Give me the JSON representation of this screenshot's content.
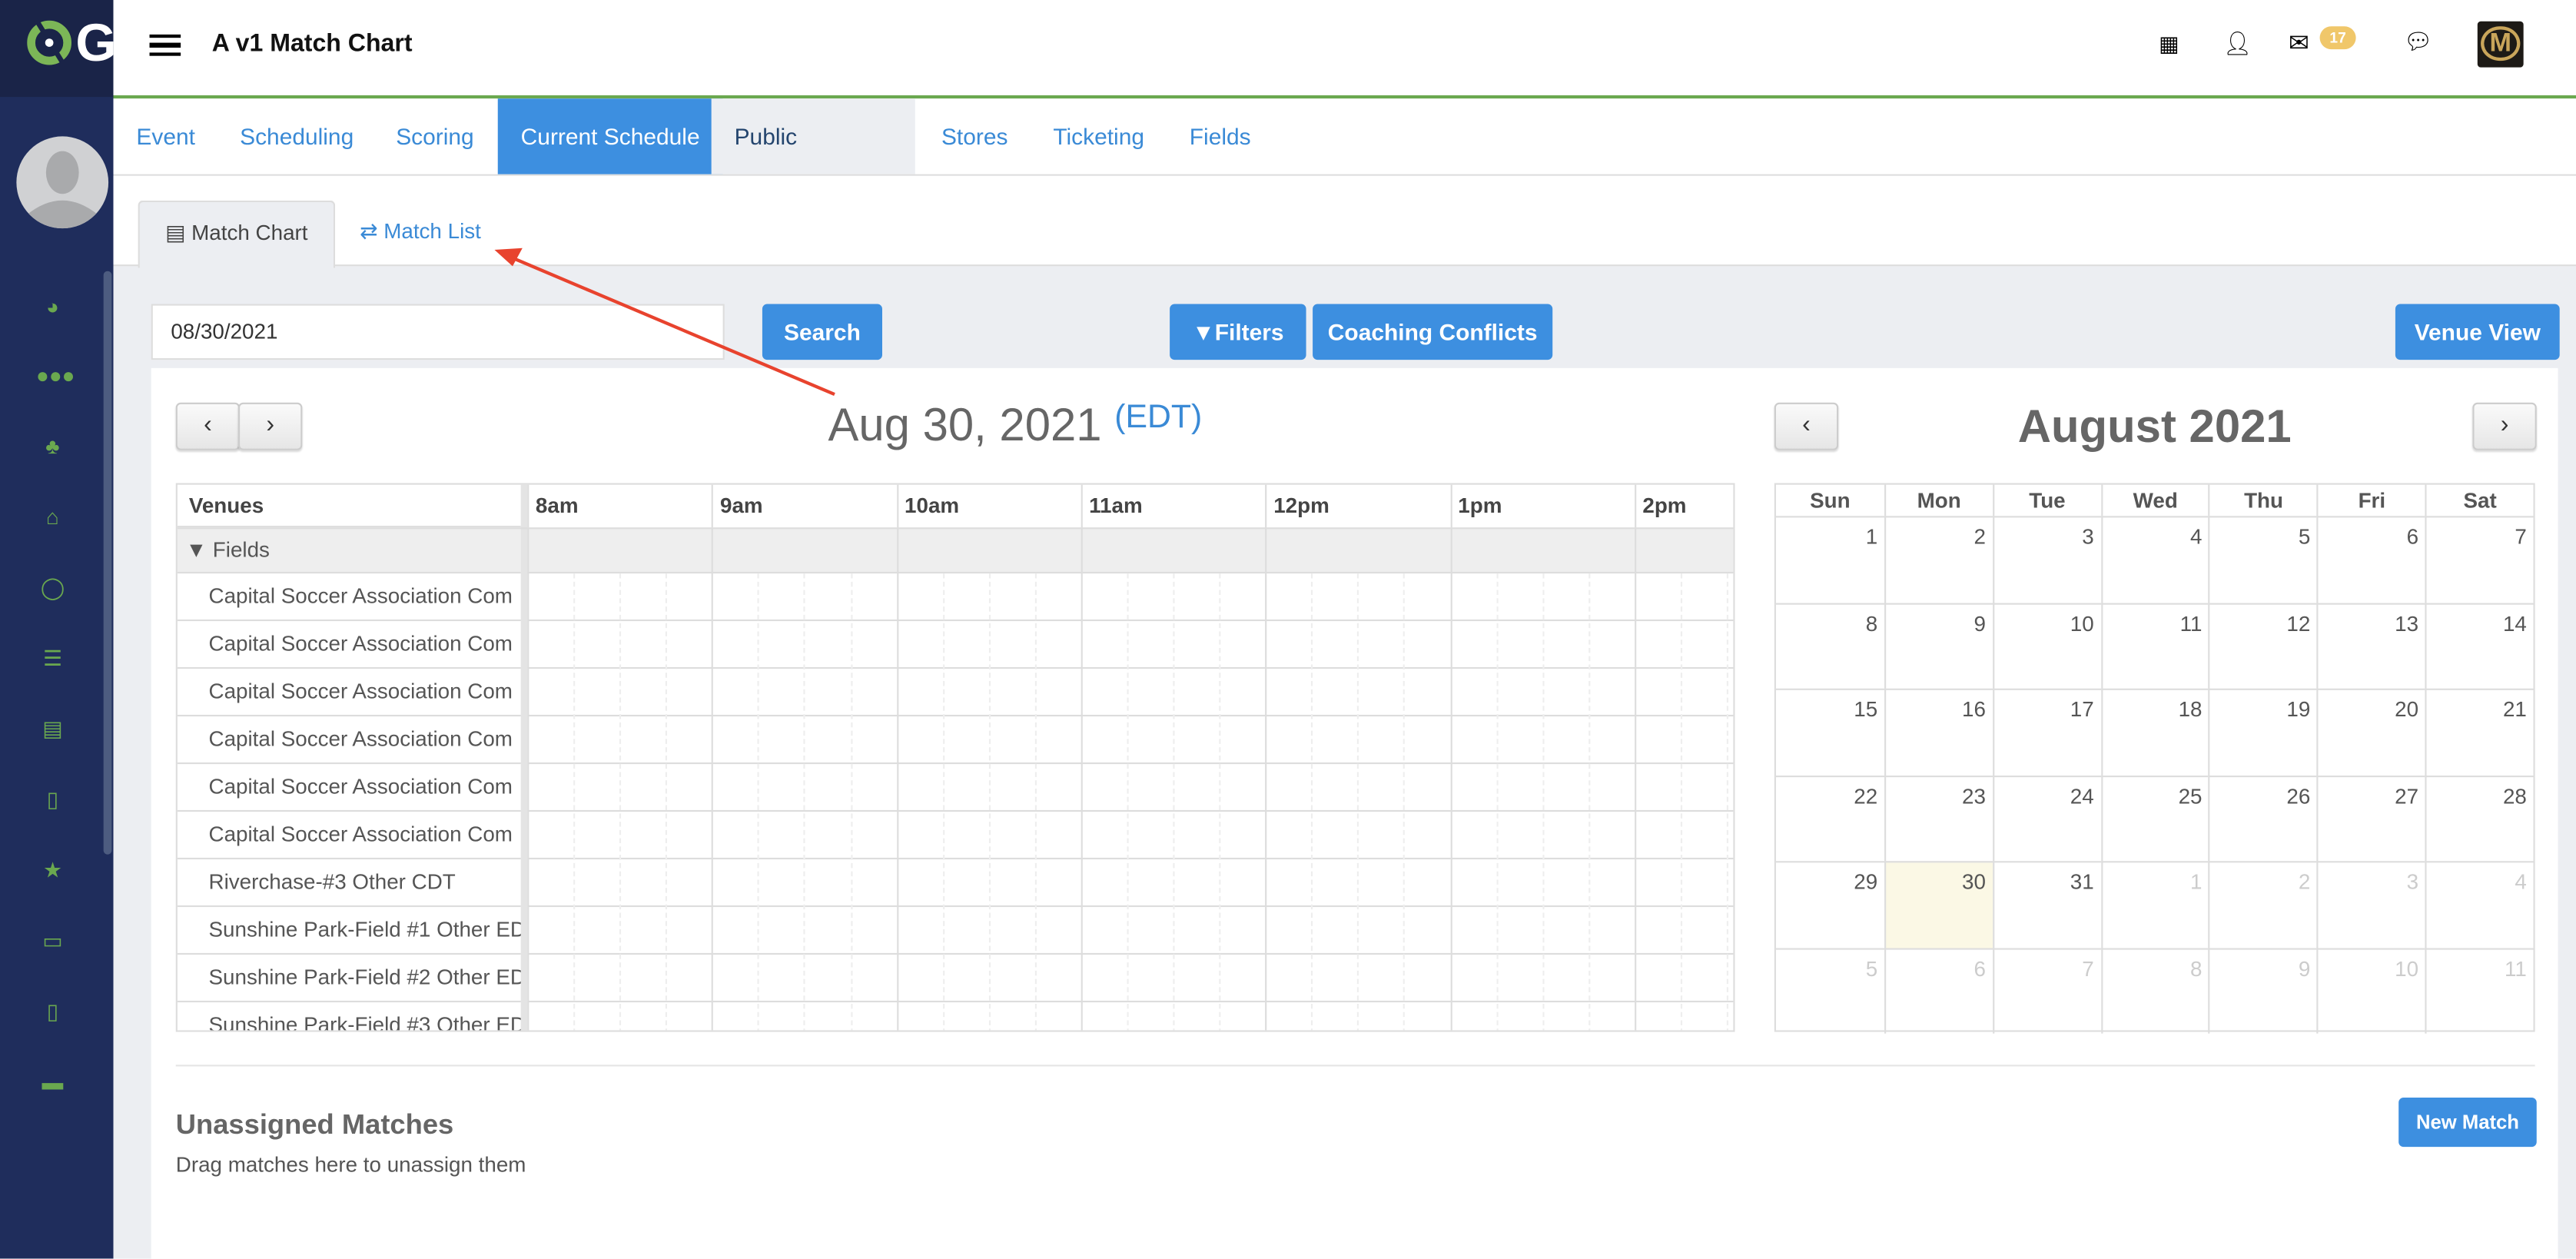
{
  "header": {
    "title": "A v1 Match Chart",
    "logo_text": "G",
    "mail_count": "17"
  },
  "tabs": [
    "Event",
    "Scheduling",
    "Scoring",
    "Current Schedule",
    "Public Schedule",
    "Stores",
    "Ticketing",
    "Fields"
  ],
  "active_tab": "Current Schedule",
  "subtabs": {
    "match_chart": "Match Chart",
    "match_list": "Match List"
  },
  "toolbar": {
    "date_value": "08/30/2021",
    "search": "Search",
    "filters": "Filters",
    "coaching_conflicts": "Coaching Conflicts",
    "venue_view": "Venue View"
  },
  "schedule": {
    "date_title": "Aug 30, 2021",
    "timezone": "(EDT)",
    "venues_header": "Venues",
    "group": "Fields",
    "hours": [
      "8am",
      "9am",
      "10am",
      "11am",
      "12pm",
      "1pm",
      "2pm"
    ],
    "venues": [
      "Capital Soccer Association Com",
      "Capital Soccer Association Com",
      "Capital Soccer Association Com",
      "Capital Soccer Association Com",
      "Capital Soccer Association Com",
      "Capital Soccer Association Com",
      "Riverchase-#3 Other CDT",
      "Sunshine Park-Field #1 Other ED",
      "Sunshine Park-Field #2 Other ED",
      "Sunshine Park-Field #3 Other ED"
    ]
  },
  "calendar": {
    "title": "August 2021",
    "weekdays": [
      "Sun",
      "Mon",
      "Tue",
      "Wed",
      "Thu",
      "Fri",
      "Sat"
    ],
    "weeks": [
      [
        "1",
        "2",
        "3",
        "4",
        "5",
        "6",
        "7"
      ],
      [
        "8",
        "9",
        "10",
        "11",
        "12",
        "13",
        "14"
      ],
      [
        "15",
        "16",
        "17",
        "18",
        "19",
        "20",
        "21"
      ],
      [
        "22",
        "23",
        "24",
        "25",
        "26",
        "27",
        "28"
      ],
      [
        "29",
        "30",
        "31",
        "1",
        "2",
        "3",
        "4"
      ],
      [
        "5",
        "6",
        "7",
        "8",
        "9",
        "10",
        "11"
      ]
    ],
    "selected": "30"
  },
  "unassigned": {
    "title": "Unassigned Matches",
    "hint": "Drag matches here to unassign them",
    "new_match": "New Match"
  },
  "colors": {
    "sidebar": "#1f2d5c",
    "accent": "#3d8fe0",
    "green": "#6aa84f",
    "badge": "#f0c76a",
    "annotation": "#e8432e"
  }
}
